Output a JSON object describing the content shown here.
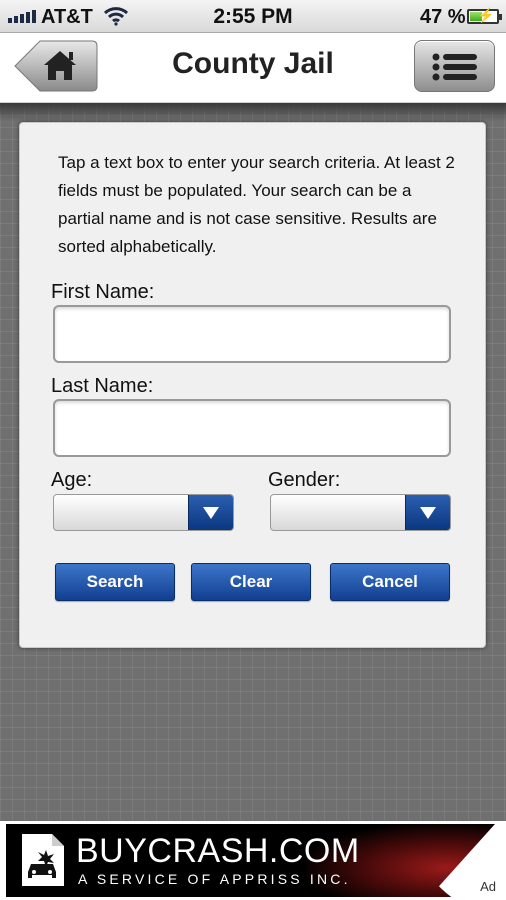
{
  "status_bar": {
    "carrier": "AT&T",
    "time": "2:55 PM",
    "battery_percent": "47 %",
    "battery_level": 0.47
  },
  "nav": {
    "title": "County Jail",
    "home_icon": "home-icon",
    "menu_icon": "menu-icon"
  },
  "form": {
    "instructions": "Tap a text box to enter your search criteria. At least 2 fields must be populated. Your search can be a partial name and is not case sensitive.  Results are sorted alphabetically.",
    "first_name_label": "First Name:",
    "first_name_value": "",
    "last_name_label": "Last Name:",
    "last_name_value": "",
    "age_label": "Age:",
    "age_value": "",
    "gender_label": "Gender:",
    "gender_value": "",
    "buttons": {
      "search": "Search",
      "clear": "Clear",
      "cancel": "Cancel"
    }
  },
  "ad": {
    "brand": "BUYCRASH.COM",
    "tagline": "A SERVICE OF APPRISS INC.",
    "label": "Ad"
  },
  "colors": {
    "button_blue": "#1a4ea0",
    "background_gray": "#707070"
  }
}
